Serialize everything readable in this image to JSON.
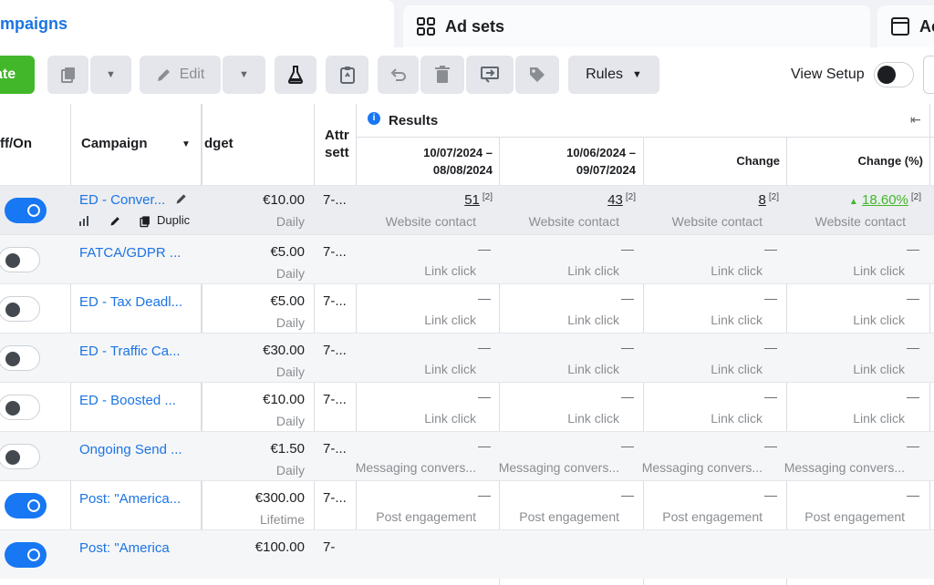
{
  "tabs": {
    "campaigns": "mpaigns",
    "adsets": "Ad sets",
    "ads": "Ac"
  },
  "toolbar": {
    "create": "ate",
    "edit": "Edit",
    "rules": "Rules",
    "view_setup": "View Setup"
  },
  "columns": {
    "offon": "ff/On",
    "campaign": "Campaign",
    "budget": "dget",
    "attr": "Attr",
    "attr2": "sett",
    "results": "Results",
    "period1": "10/07/2024 –",
    "period1b": "08/08/2024",
    "period2": "10/06/2024 –",
    "period2b": "09/07/2024",
    "change": "Change",
    "change_pct": "Change (%)"
  },
  "first_row": {
    "name": "ED - Conver...",
    "actions": "Duplic",
    "budget": "€10.00",
    "budget_type": "Daily",
    "attr": "7-...",
    "r1": "51",
    "r2": "43",
    "r3": "8",
    "r4": "18.60%",
    "note": "[2]",
    "metric": "Website contact"
  },
  "rows": [
    {
      "name": "FATCA/GDPR ...",
      "budget": "€5.00",
      "type": "Daily",
      "attr": "7-...",
      "dash": "—",
      "metric": "Link click"
    },
    {
      "name": "ED - Tax Deadl...",
      "budget": "€5.00",
      "type": "Daily",
      "attr": "7-...",
      "dash": "—",
      "metric": "Link click"
    },
    {
      "name": "ED - Traffic Ca...",
      "budget": "€30.00",
      "type": "Daily",
      "attr": "7-...",
      "dash": "—",
      "metric": "Link click"
    },
    {
      "name": "ED - Boosted ...",
      "budget": "€10.00",
      "type": "Daily",
      "attr": "7-...",
      "dash": "—",
      "metric": "Link click"
    },
    {
      "name": "Ongoing Send ...",
      "budget": "€1.50",
      "type": "Daily",
      "attr": "7-...",
      "dash": "—",
      "metric": "Messaging convers..."
    },
    {
      "name": "Post: \"America...",
      "budget": "€300.00",
      "type": "Lifetime",
      "attr": "7-...",
      "dash": "—",
      "metric": "Post engagement"
    },
    {
      "name": "Post: \"America",
      "budget": "€100.00",
      "type": "",
      "attr": "7-",
      "dash": "",
      "metric": ""
    }
  ]
}
